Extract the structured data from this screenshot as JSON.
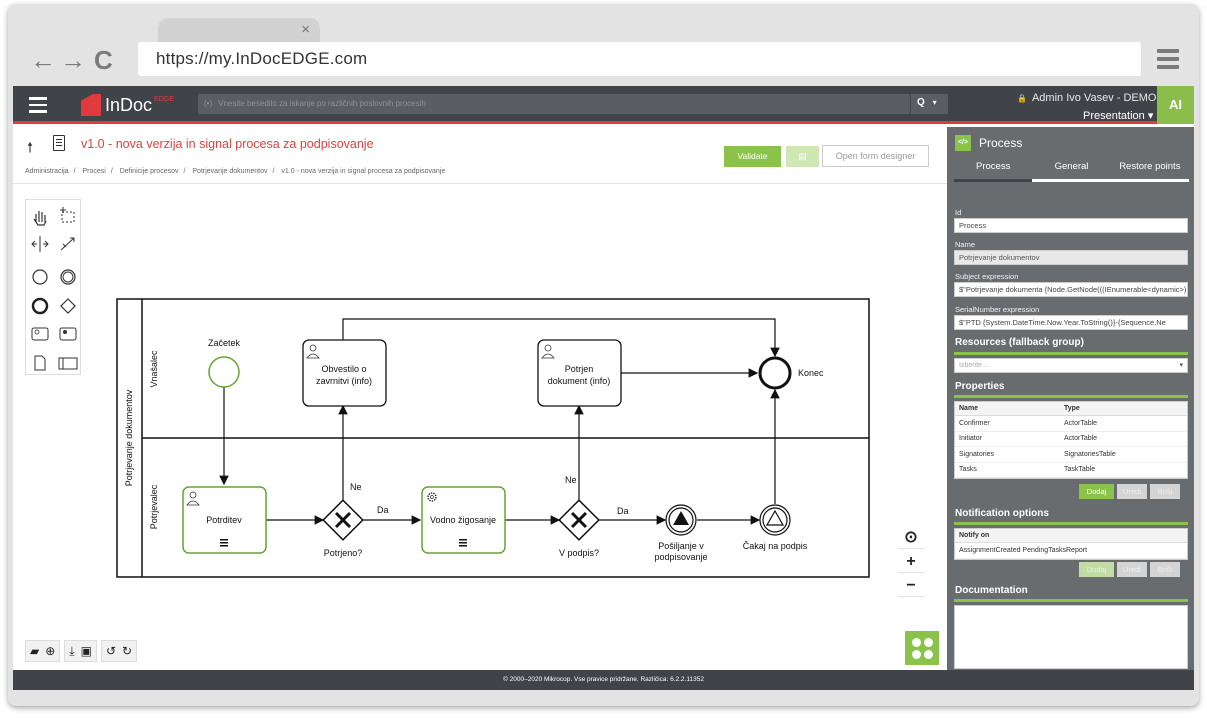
{
  "browser": {
    "url": "https://my.InDocEDGE.com",
    "tab_close": "×",
    "back": "←",
    "forward": "→",
    "reload": "C"
  },
  "app": {
    "logo_text": "InDoc",
    "logo_sup": "EDGE",
    "search_placeholder": "Vnesite besedilo za iskanje po različnih poslovnih procesih",
    "search_icon": "Q",
    "search_caret": "▾",
    "user_name": "Admin Ivo Vasev - DEMO",
    "user_role": "Presentation ▾",
    "avatar": "AI",
    "accent": "#e0393e",
    "green": "#8bc34a"
  },
  "page": {
    "title": "v1.0 - nova verzija in signal procesa za podpisovanje",
    "breadcrumb": [
      "Administracija",
      "Procesi",
      "Definicije procesov",
      "Potrjevanje dokumentov",
      "v1.0 - nova verzija in signal procesa za podpisovanje"
    ],
    "buttons": {
      "validate": "Validate",
      "save_icon": "▤",
      "open_form_designer": "Open form designer"
    }
  },
  "diagram": {
    "pool": "Potrjevanje dokumentov",
    "lanes": [
      "Vnašalec",
      "Potrjevalec"
    ],
    "start": "Začetek",
    "end": "Konec",
    "task_notify": "Obvestilo o zavrnitvi (info)",
    "task_confirmed": "Potrjen dokument (info)",
    "task_confirm": "Potrditev",
    "task_stamp": "Vodno žigosanje",
    "gateway1": "Potrjeno?",
    "gateway2": "V podpis?",
    "yes1": "Da",
    "no1": "Ne",
    "yes2": "Da",
    "no2": "Ne",
    "event_send": "Pošiljanje v podpisovanje",
    "event_wait": "Čakaj na podpis"
  },
  "footer": "© 2000–2020 Mikrocop. Vse pravice pridržane.  Različica:  6.2.2.11352",
  "panel": {
    "title": "Process",
    "icon": "</>",
    "tabs": [
      "Process",
      "General",
      "Restore points"
    ],
    "id_label": "Id",
    "id_value": "Process",
    "name_label": "Name",
    "name_value": "Potrjevanje dokumentov",
    "subject_label": "Subject expression",
    "subject_value": "$\"Potrjevanje dokumenta {Node.GetNode(((IEnumerable<dynamic>)",
    "serial_label": "SerialNumber expression",
    "serial_value": "$\"PTD {System.DateTime.Now.Year.ToString()}-{Sequence.Ne",
    "resources_title": "Resources (fallback group)",
    "resources_placeholder": "Izberite ...",
    "properties_title": "Properties",
    "properties_cols": [
      "Name",
      "Type"
    ],
    "properties_rows": [
      {
        "name": "Confirmer",
        "type": "ActorTable"
      },
      {
        "name": "Initiator",
        "type": "ActorTable"
      },
      {
        "name": "Signatories",
        "type": "SignatoriesTable"
      },
      {
        "name": "Tasks",
        "type": "TaskTable"
      }
    ],
    "btn_add": "Dodaj",
    "btn_edit": "Uredi",
    "btn_delete": "Briši",
    "notif_title": "Notification options",
    "notif_col": "Notify on",
    "notif_value": "AssignmentCreated PendingTasksReport",
    "doc_title": "Documentation"
  }
}
